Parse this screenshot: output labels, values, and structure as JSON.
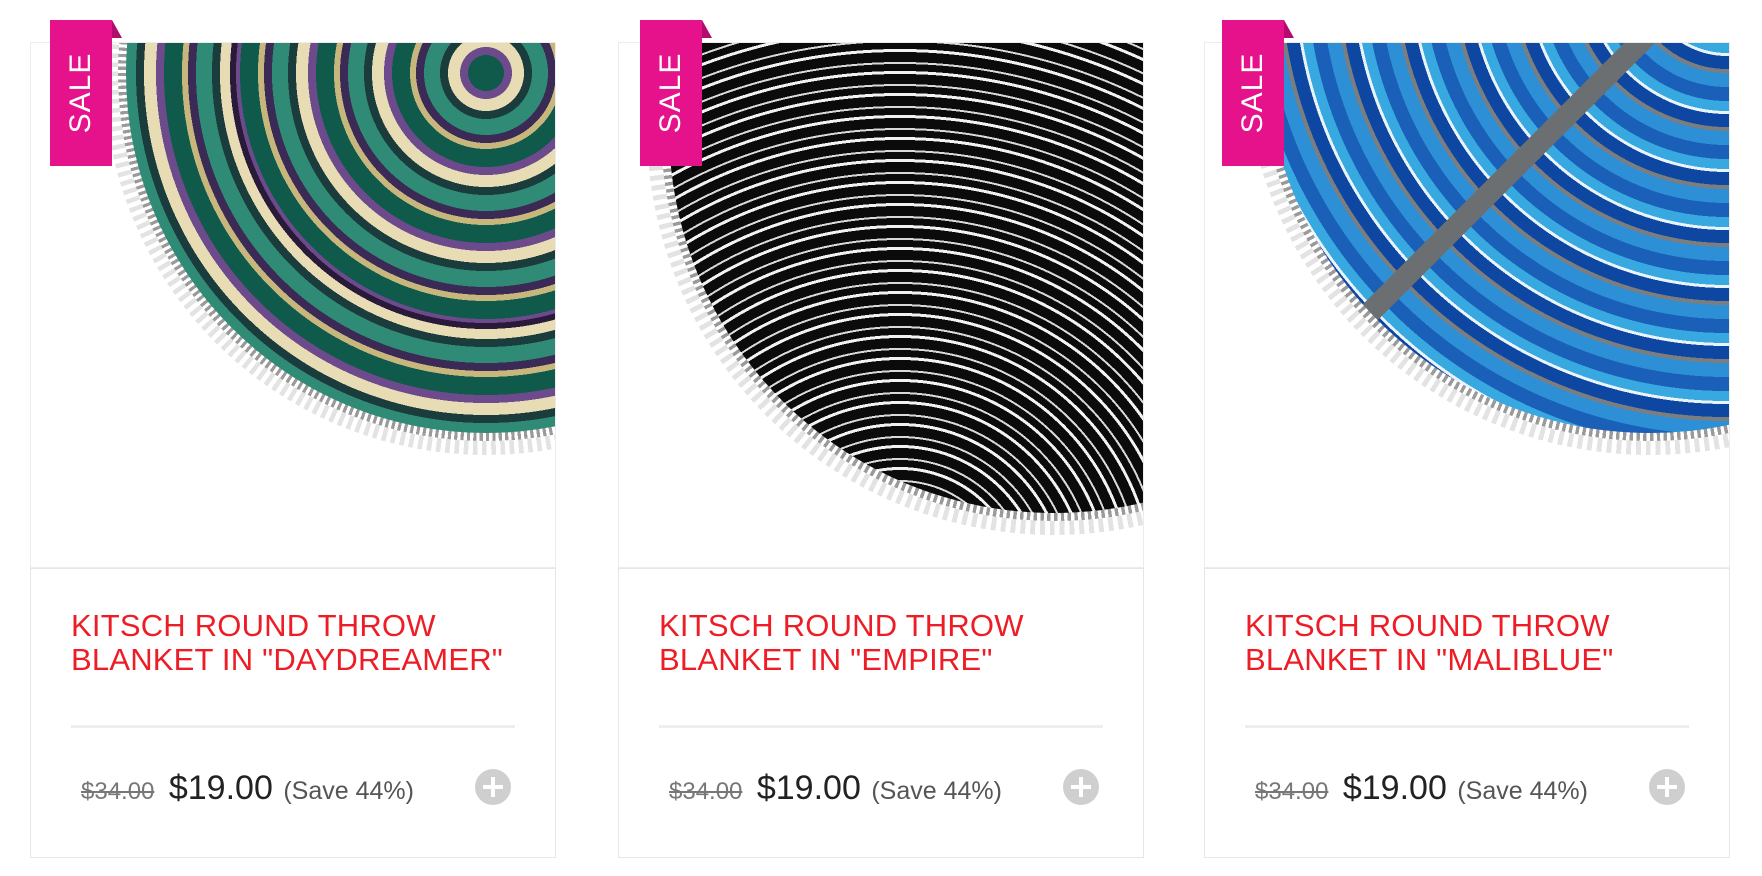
{
  "products": [
    {
      "badge": "SALE",
      "title_line1": "KITSCH ROUND THROW",
      "title_line2": "BLANKET IN \"DAYDREAMER\"",
      "old_price": "$34.00",
      "price": "$19.00",
      "save": "(Save 44%)"
    },
    {
      "badge": "SALE",
      "title_line1": "KITSCH ROUND THROW",
      "title_line2": "BLANKET IN \"EMPIRE\"",
      "old_price": "$34.00",
      "price": "$19.00",
      "save": "(Save 44%)"
    },
    {
      "badge": "SALE",
      "title_line1": "KITSCH ROUND THROW",
      "title_line2": "BLANKET IN \"MALIBLUE\"",
      "old_price": "$34.00",
      "price": "$19.00",
      "save": "(Save 44%)"
    }
  ],
  "colors": {
    "sale_badge": "#e5128b",
    "title": "#ee1c25",
    "add_button": "#cfcfcf"
  },
  "icons": {
    "add": "plus-circle-icon"
  }
}
